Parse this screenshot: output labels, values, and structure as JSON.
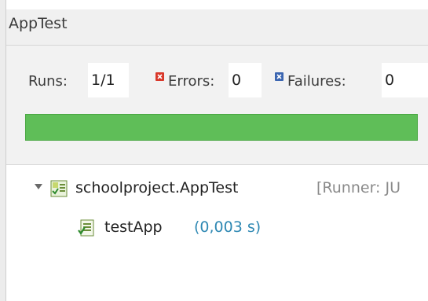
{
  "view": {
    "title": "AppTest"
  },
  "counters": {
    "runs_label": "Runs:",
    "runs_value": "1/1",
    "errors_label": "Errors:",
    "errors_value": "0",
    "failures_label": "Failures:",
    "failures_value": "0"
  },
  "progress": {
    "fraction": 1.0,
    "color": "#5fbe58"
  },
  "tree": {
    "root": {
      "icon": "suite-passed-icon",
      "label": "schoolproject.AppTest",
      "runner": "[Runner: JU"
    },
    "children": [
      {
        "icon": "test-passed-icon",
        "label": "testApp",
        "time": "(0,003 s)"
      }
    ]
  },
  "colors": {
    "error": "#d9382a",
    "failure": "#3c66b1",
    "success": "#5fbe58",
    "time": "#2e88b3"
  }
}
